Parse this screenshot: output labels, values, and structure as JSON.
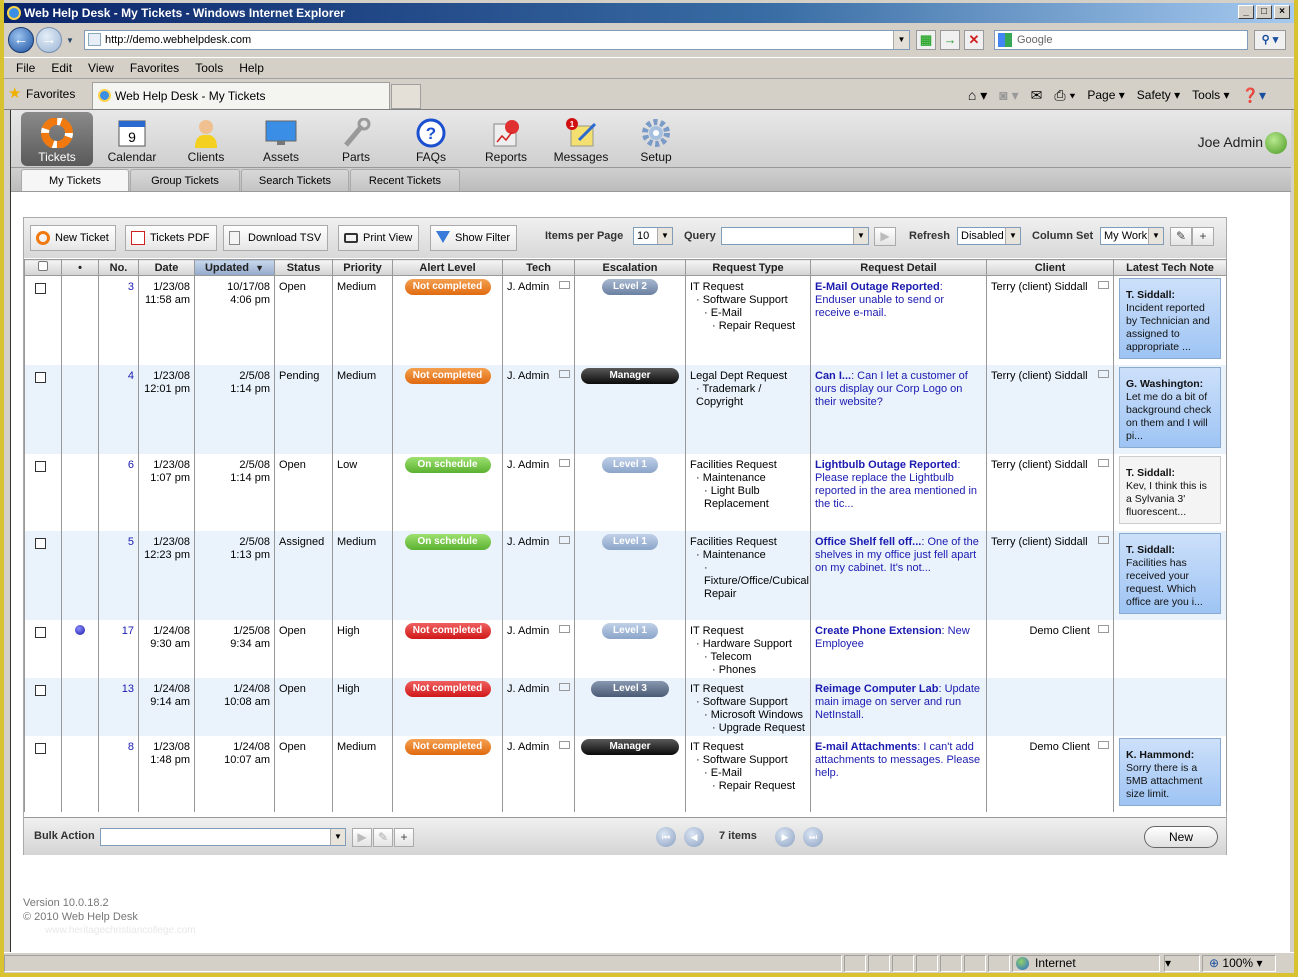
{
  "browser": {
    "title": "Web Help Desk - My Tickets - Windows Internet Explorer",
    "url": "http://demo.webhelpdesk.com",
    "search_placeholder": "Google",
    "menu": [
      "File",
      "Edit",
      "View",
      "Favorites",
      "Tools",
      "Help"
    ],
    "favorites_label": "Favorites",
    "tab_title": "Web Help Desk - My Tickets",
    "commands": [
      "Page",
      "Safety",
      "Tools"
    ],
    "status_zone": "Internet",
    "zoom": "100%"
  },
  "app": {
    "nav": [
      {
        "label": "Tickets",
        "icon": "lifebuoy-icon",
        "active": true
      },
      {
        "label": "Calendar",
        "icon": "calendar-icon",
        "badge_text": "9"
      },
      {
        "label": "Clients",
        "icon": "person-icon"
      },
      {
        "label": "Assets",
        "icon": "monitor-icon"
      },
      {
        "label": "Parts",
        "icon": "wrench-icon"
      },
      {
        "label": "FAQs",
        "icon": "question-icon"
      },
      {
        "label": "Reports",
        "icon": "report-icon"
      },
      {
        "label": "Messages",
        "icon": "notepad-icon",
        "badge": "1"
      },
      {
        "label": "Setup",
        "icon": "gear-icon"
      }
    ],
    "user": "Joe Admin",
    "subtabs": [
      "My Tickets",
      "Group Tickets",
      "Search Tickets",
      "Recent Tickets"
    ],
    "active_subtab": "My Tickets"
  },
  "toolbar": {
    "new_ticket": "New Ticket",
    "tickets_pdf": "Tickets PDF",
    "download_tsv": "Download TSV",
    "print_view": "Print View",
    "show_filter": "Show Filter",
    "items_per_page_label": "Items per Page",
    "items_per_page": "10",
    "query_label": "Query",
    "query_value": "",
    "refresh_label": "Refresh",
    "refresh_value": "Disabled",
    "column_set_label": "Column Set",
    "column_set_value": "My Work"
  },
  "table": {
    "columns": [
      "",
      "•",
      "No.",
      "Date",
      "Updated",
      "Status",
      "Priority",
      "Alert Level",
      "Tech",
      "Escalation",
      "Request Type",
      "Request Detail",
      "Client",
      "Latest Tech Note"
    ],
    "sorted_column": "Updated",
    "rows": [
      {
        "dot": false,
        "no": "3",
        "date": "1/23/08",
        "date_time": "11:58 am",
        "updated": "10/17/08",
        "updated_time": "4:06 pm",
        "status": "Open",
        "priority": "Medium",
        "alert": "Not completed",
        "alert_color": "orange",
        "tech": "J. Admin",
        "escalation": "Level 2",
        "esc_class": "l2",
        "request_type": [
          "IT Request",
          "Software Support",
          "E-Mail",
          "Repair Request"
        ],
        "detail_title": "E-Mail Outage Reported",
        "detail_text": ": Enduser unable to send or receive e-mail.",
        "client": "Terry (client) Siddall",
        "client_align": "left",
        "note_author": "T. Siddall:",
        "note_text": "Incident reported by Technician and assigned to appropriate ...",
        "note_style": "blue"
      },
      {
        "dot": false,
        "no": "4",
        "date": "1/23/08",
        "date_time": "12:01 pm",
        "updated": "2/5/08",
        "updated_time": "1:14 pm",
        "status": "Pending",
        "priority": "Medium",
        "alert": "Not completed",
        "alert_color": "orange",
        "tech": "J. Admin",
        "escalation": "Manager",
        "esc_class": "mgr",
        "request_type": [
          "Legal Dept Request",
          "Trademark / Copyright"
        ],
        "detail_title": "Can I...",
        "detail_text": ": Can I let a customer of ours display our Corp Logo on their website?",
        "client": "Terry (client) Siddall",
        "client_align": "left",
        "note_author": "G. Washington:",
        "note_text": "Let me do a bit of background check on them and I will pi...",
        "note_style": "blue"
      },
      {
        "dot": false,
        "no": "6",
        "date": "1/23/08",
        "date_time": "1:07 pm",
        "updated": "2/5/08",
        "updated_time": "1:14 pm",
        "status": "Open",
        "priority": "Low",
        "alert": "On schedule",
        "alert_color": "green",
        "tech": "J. Admin",
        "escalation": "Level 1",
        "esc_class": "l1",
        "request_type": [
          "Facilities Request",
          "Maintenance",
          "Light Bulb Replacement"
        ],
        "detail_title": "Lightbulb Outage Reported",
        "detail_text": ": Please replace the Lightbulb reported in the area mentioned in the tic...",
        "client": "Terry (client) Siddall",
        "client_align": "left",
        "note_author": "T. Siddall:",
        "note_text": " Kev, I think this is a Sylvania 3' fluorescent...",
        "note_style": "grey"
      },
      {
        "dot": false,
        "no": "5",
        "date": "1/23/08",
        "date_time": "12:23 pm",
        "updated": "2/5/08",
        "updated_time": "1:13 pm",
        "status": "Assigned",
        "priority": "Medium",
        "alert": "On schedule",
        "alert_color": "green",
        "tech": "J. Admin",
        "escalation": "Level 1",
        "esc_class": "l1",
        "request_type": [
          "Facilities Request",
          "Maintenance",
          "Fixture/Office/Cubical Repair"
        ],
        "detail_title": "Office Shelf fell off...",
        "detail_text": ": One of the shelves in my office just fell apart on my cabinet. It's not...",
        "client": "Terry (client) Siddall",
        "client_align": "left",
        "note_author": "T. Siddall:",
        "note_text": "Facilities has received your request. Which office are you i...",
        "note_style": "blue"
      },
      {
        "dot": true,
        "no": "17",
        "date": "1/24/08",
        "date_time": "9:30 am",
        "updated": "1/25/08",
        "updated_time": "9:34 am",
        "status": "Open",
        "priority": "High",
        "alert": "Not completed",
        "alert_color": "red",
        "tech": "J. Admin",
        "escalation": "Level 1",
        "esc_class": "l1",
        "request_type": [
          "IT Request",
          "Hardware Support",
          "Telecom",
          "Phones"
        ],
        "detail_title": "Create Phone Extension",
        "detail_text": ": New Employee",
        "client": "Demo Client",
        "client_align": "right",
        "note_author": "",
        "note_text": "",
        "note_style": "none"
      },
      {
        "dot": false,
        "no": "13",
        "date": "1/24/08",
        "date_time": "9:14 am",
        "updated": "1/24/08",
        "updated_time": "10:08 am",
        "status": "Open",
        "priority": "High",
        "alert": "Not completed",
        "alert_color": "red",
        "tech": "J. Admin",
        "escalation": "Level 3",
        "esc_class": "l3",
        "request_type": [
          "IT Request",
          "Software Support",
          "Microsoft Windows",
          "Upgrade Request"
        ],
        "detail_title": "Reimage Computer Lab",
        "detail_text": ": Update main image on server and run NetInstall.",
        "client": "",
        "client_align": "right",
        "note_author": "",
        "note_text": "",
        "note_style": "none"
      },
      {
        "dot": false,
        "no": "8",
        "date": "1/23/08",
        "date_time": "1:48 pm",
        "updated": "1/24/08",
        "updated_time": "10:07 am",
        "status": "Open",
        "priority": "Medium",
        "alert": "Not completed",
        "alert_color": "orange",
        "tech": "J. Admin",
        "escalation": "Manager",
        "esc_class": "mgr",
        "request_type": [
          "IT Request",
          "Software Support",
          "E-Mail",
          "Repair Request"
        ],
        "detail_title": "E-mail Attachments",
        "detail_text": ": I can't add attachments to messages. Please help.",
        "client": "Demo Client",
        "client_align": "right",
        "note_author": "K. Hammond:",
        "note_text": "Sorry there is a 5MB attachment size limit.",
        "note_style": "blue"
      }
    ]
  },
  "footer": {
    "bulk_action_label": "Bulk Action",
    "bulk_action_value": "",
    "items_count": "7 items",
    "new_button": "New"
  },
  "page_footer": {
    "version": "Version 10.0.18.2",
    "copyright": "© 2010 Web Help Desk",
    "watermark": "www.heritagechristiancollege.com"
  }
}
